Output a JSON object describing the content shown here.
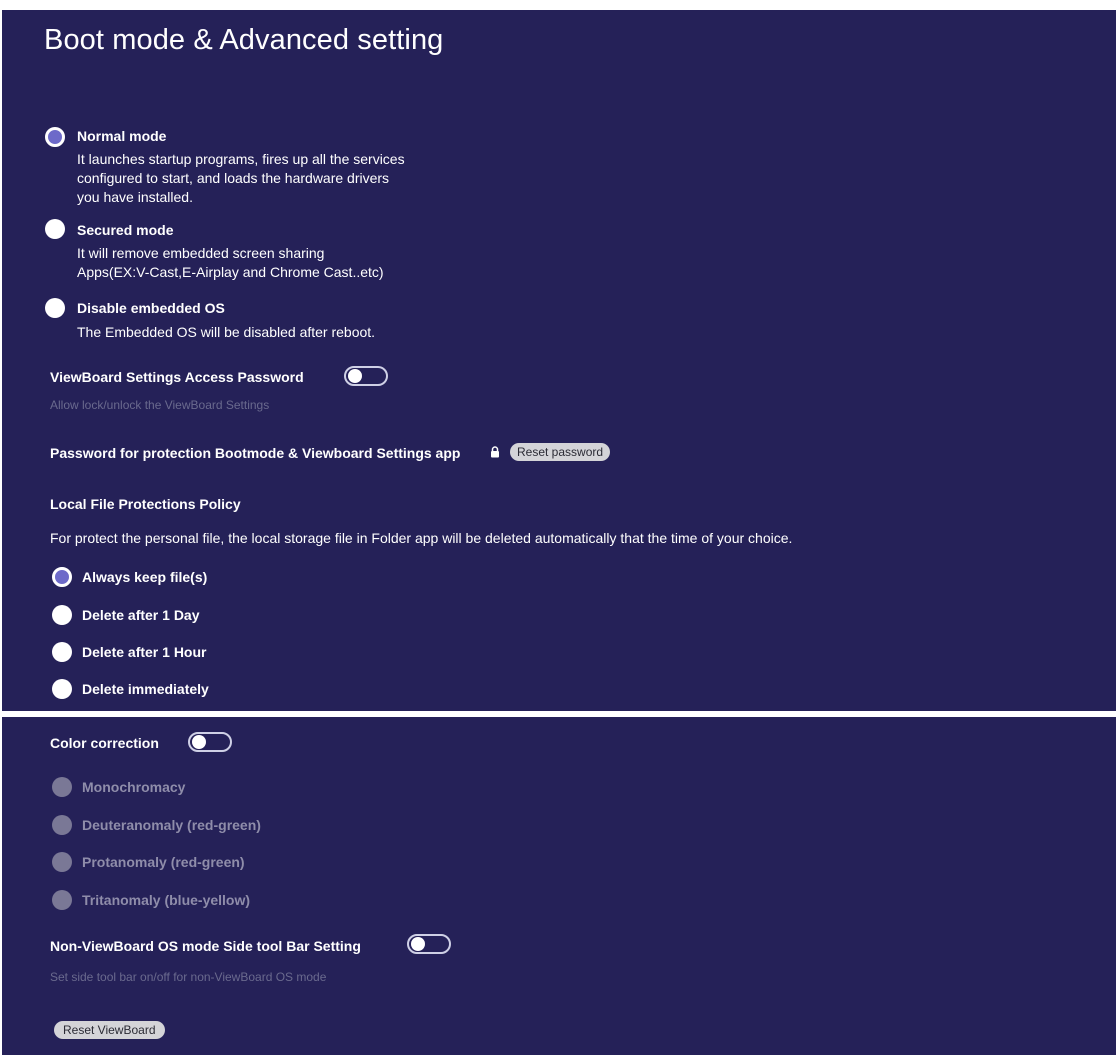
{
  "page": {
    "title": "Boot mode & Advanced setting"
  },
  "boot_modes": [
    {
      "label": "Normal mode",
      "selected": true,
      "desc": [
        "It launches startup programs, fires up all the services",
        "configured to start, and loads the hardware drivers",
        "you have installed."
      ]
    },
    {
      "label": "Secured mode",
      "selected": false,
      "desc": [
        "It will remove embedded screen sharing",
        "Apps(EX:V-Cast,E-Airplay and Chrome Cast..etc)"
      ]
    },
    {
      "label": "Disable embedded OS",
      "selected": false,
      "desc": [
        "The Embedded OS will be disabled after reboot."
      ]
    }
  ],
  "access_password": {
    "label": "ViewBoard Settings Access Password",
    "enabled": false,
    "sub": "Allow lock/unlock the ViewBoard Settings"
  },
  "protection": {
    "label": "Password for protection Bootmode & Viewboard Settings app",
    "icon": "lock-icon",
    "reset_label": "Reset password"
  },
  "file_policy": {
    "heading": "Local File Protections Policy",
    "desc": "For protect the personal file, the local storage file in Folder app will be deleted automatically that the time of your choice.",
    "options": [
      {
        "label": "Always keep file(s)",
        "selected": true
      },
      {
        "label": "Delete after 1 Day",
        "selected": false
      },
      {
        "label": "Delete after 1 Hour",
        "selected": false
      },
      {
        "label": "Delete immediately",
        "selected": false
      }
    ]
  },
  "color_correction": {
    "label": "Color correction",
    "enabled": false,
    "options": [
      {
        "label": "Monochromacy"
      },
      {
        "label": "Deuteranomaly (red-green)"
      },
      {
        "label": "Protanomaly (red-green)"
      },
      {
        "label": "Tritanomaly (blue-yellow)"
      }
    ]
  },
  "side_toolbar": {
    "label": "Non-ViewBoard OS mode Side tool Bar Setting",
    "enabled": false,
    "sub": "Set side tool bar on/off for non-ViewBoard OS mode"
  },
  "reset_viewboard": {
    "label": "Reset ViewBoard"
  },
  "colors": {
    "background": "#252158",
    "radio_checked": "#6d6ac9",
    "radio_disabled": "#7a7896",
    "sub_text": "#6a6a8e"
  }
}
